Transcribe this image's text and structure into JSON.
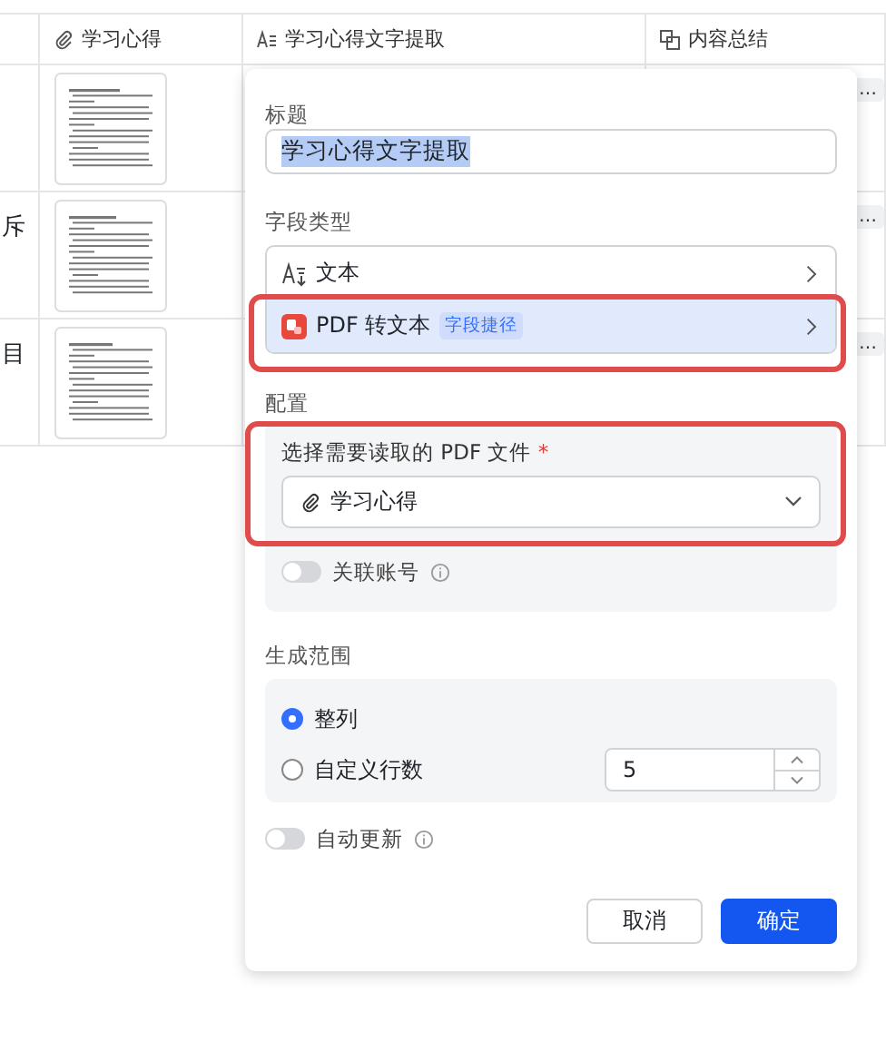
{
  "table": {
    "columns": [
      {
        "kind": "blank"
      },
      {
        "kind": "attachment",
        "label": "学习心得"
      },
      {
        "kind": "text",
        "label": "学习心得文字提取"
      },
      {
        "kind": "summary",
        "label": "内容总结"
      }
    ],
    "rows": [
      {
        "cell_1": "",
        "cell_4": "…"
      },
      {
        "cell_1": "斥",
        "cell_4": "…"
      },
      {
        "cell_1": "目",
        "cell_4": "…"
      }
    ]
  },
  "popup": {
    "title_label": "标题",
    "title_value": "学习心得文字提取",
    "type_label": "字段类型",
    "types": [
      {
        "kind": "text",
        "label": "文本",
        "selected": false
      },
      {
        "kind": "pdf",
        "label": "PDF 转文本",
        "tag": "字段捷径",
        "selected": true
      }
    ],
    "config_label": "配置",
    "file_label": "选择需要读取的 PDF 文件",
    "required_mark": "*",
    "file_value": "学习心得",
    "link_account": {
      "label": "关联账号",
      "on": false
    },
    "range_label": "生成范围",
    "range_options": [
      {
        "label": "整列",
        "selected": true
      },
      {
        "label": "自定义行数",
        "selected": false,
        "value": "5"
      }
    ],
    "auto_update": {
      "label": "自动更新",
      "on": false
    },
    "buttons": [
      {
        "label": "取消",
        "kind": "secondary"
      },
      {
        "label": "确定",
        "kind": "primary"
      }
    ]
  }
}
